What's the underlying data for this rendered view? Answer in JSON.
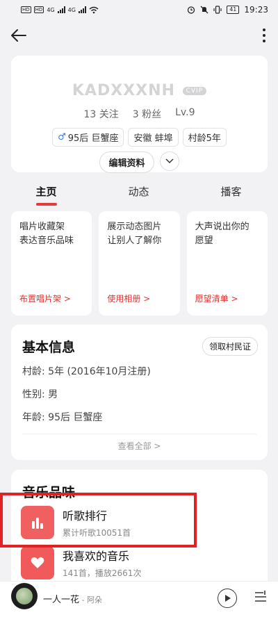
{
  "status_bar": {
    "carrier_1": "HD",
    "carrier_2": "HD",
    "net_1": "4G",
    "net_2": "4G",
    "battery": "41",
    "time": "19:23"
  },
  "profile": {
    "username": "KADXXXNH",
    "user_tag": "CVIP",
    "follows": "13 关注",
    "fans": "3 粉丝",
    "level": "Lv.9",
    "gender_symbol": "♂",
    "age_sign": "95后 巨蟹座",
    "location": "安徽 蚌埠",
    "village_age": "村龄5年",
    "edit_label": "编辑资料"
  },
  "tabs": [
    {
      "label": "主页"
    },
    {
      "label": "动态"
    },
    {
      "label": "播客"
    }
  ],
  "feature_cards": [
    {
      "desc": "唱片收藏架\n表达音乐品味",
      "link": "布置唱片架 >"
    },
    {
      "desc": "展示动态图片\n让别人了解你",
      "link": "使用相册 >"
    },
    {
      "desc": "大声说出你的\n愿望",
      "link": "愿望清单 >"
    }
  ],
  "basic_info": {
    "title": "基本信息",
    "villager_button": "领取村民证",
    "rows": [
      {
        "text": "村龄:  5年 (2016年10月注册)"
      },
      {
        "text": "性别:  男"
      },
      {
        "text": "年龄:  95后 巨蟹座"
      }
    ],
    "view_all": "查看全部 >"
  },
  "music": {
    "title": "音乐品味",
    "items": [
      {
        "title": "听歌排行",
        "subtitle": "累计听歌10051首"
      },
      {
        "title": "我喜欢的音乐",
        "subtitle": "141首，播放2661次"
      }
    ]
  },
  "player": {
    "song": "一人一花",
    "artist": " - 阿朵"
  },
  "colors": {
    "accent": "#e63a3a",
    "icon_red": "#f05a5a",
    "highlight": "#e02222"
  }
}
